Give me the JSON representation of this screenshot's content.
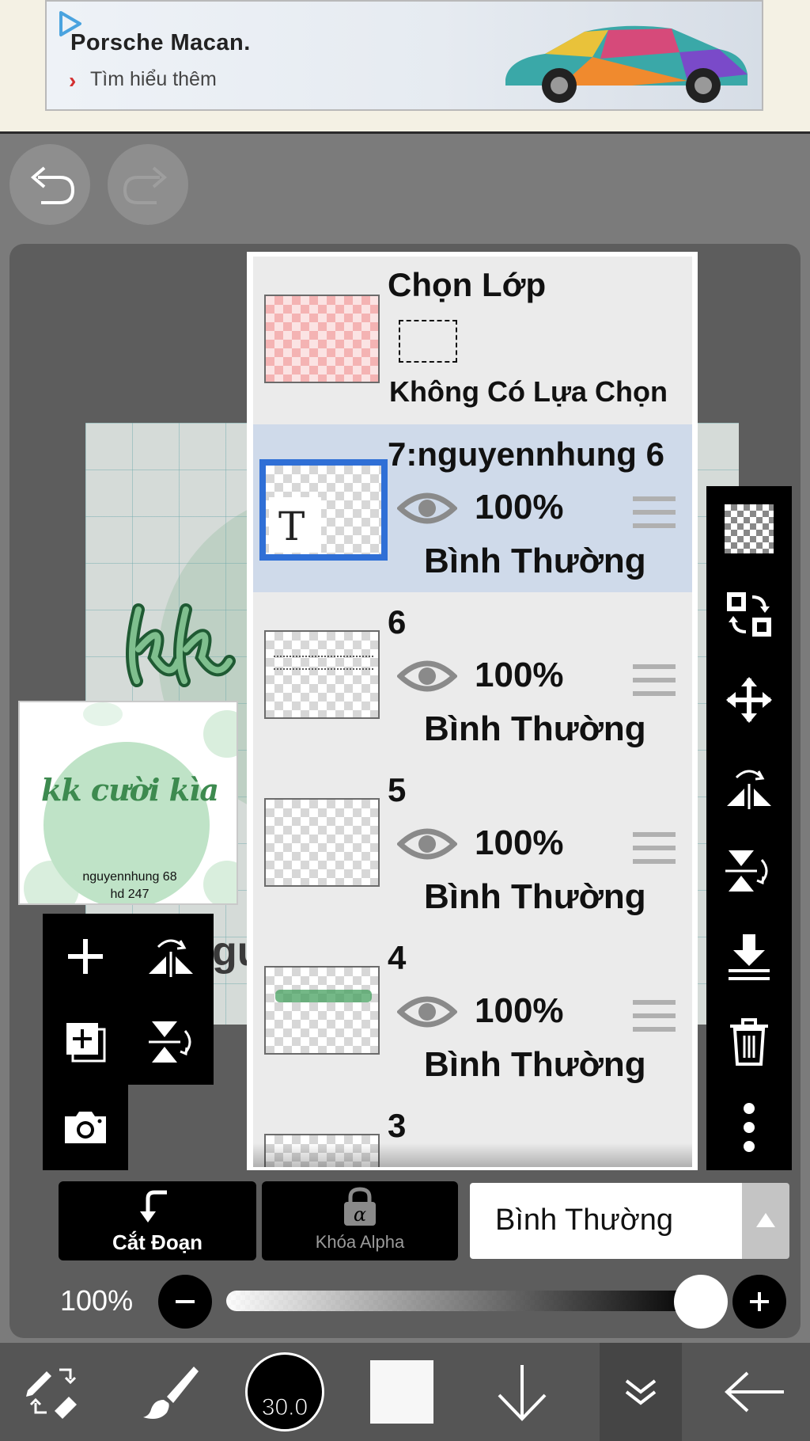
{
  "ad": {
    "title": "Porsche Macan.",
    "link_label": "Tìm hiểu thêm"
  },
  "preview": {
    "text": "kk cười kìa",
    "line1": "nguyennhung  68",
    "line2": "hd  247"
  },
  "layer_panel": {
    "selection": {
      "title": "Chọn Lớp",
      "status": "Không Có Lựa Chọn"
    },
    "layers": [
      {
        "name": "7:nguyennhung 6",
        "opacity": "100%",
        "blend": "Bình Thường",
        "selected": true
      },
      {
        "name": "6",
        "opacity": "100%",
        "blend": "Bình Thường",
        "selected": false
      },
      {
        "name": "5",
        "opacity": "100%",
        "blend": "Bình Thường",
        "selected": false
      },
      {
        "name": "4",
        "opacity": "100%",
        "blend": "Bình Thường",
        "selected": false
      },
      {
        "name": "3",
        "opacity": "",
        "blend": "",
        "selected": false
      }
    ]
  },
  "controls": {
    "clipping_label": "Cắt Đoạn",
    "alpha_lock_label": "Khóa Alpha",
    "blend_mode": "Bình Thường",
    "opacity_label": "100%",
    "opacity_value": 1.0
  },
  "bottom_nav": {
    "brush_size": "30.0"
  },
  "colors": {
    "selected_layer_bg": "#cfdaea",
    "selected_border": "#2f6fd6",
    "panel_bg": "#ebebeb",
    "toolbar_bg": "#000000"
  }
}
